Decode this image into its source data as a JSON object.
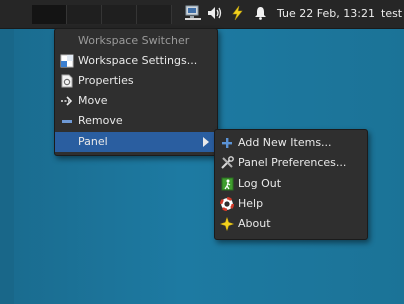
{
  "panel": {
    "clock": "Tue 22 Feb, 13:21",
    "user": "test",
    "tray_icons": [
      "network-icon",
      "volume-icon",
      "power-manager-icon",
      "notifications-bell-icon"
    ]
  },
  "context_menu": {
    "header": "Workspace Switcher",
    "items": [
      {
        "label": "Workspace Settings...",
        "icon": "workspace-settings-icon"
      },
      {
        "label": "Properties",
        "icon": "properties-icon"
      },
      {
        "label": "Move",
        "icon": "move-icon"
      },
      {
        "label": "Remove",
        "icon": "remove-icon"
      },
      {
        "label": "Panel",
        "icon": "",
        "submenu": true
      }
    ]
  },
  "panel_submenu": {
    "items": [
      {
        "label": "Add New Items...",
        "icon": "add-icon"
      },
      {
        "label": "Panel Preferences...",
        "icon": "preferences-icon"
      },
      {
        "label": "Log Out",
        "icon": "log-out-icon"
      },
      {
        "label": "Help",
        "icon": "help-icon"
      },
      {
        "label": "About",
        "icon": "about-icon"
      }
    ]
  },
  "colors": {
    "desktop": "#1b7296",
    "panel": "#262626",
    "menu": "#2f2f2f",
    "selection": "#2a5ea0"
  }
}
